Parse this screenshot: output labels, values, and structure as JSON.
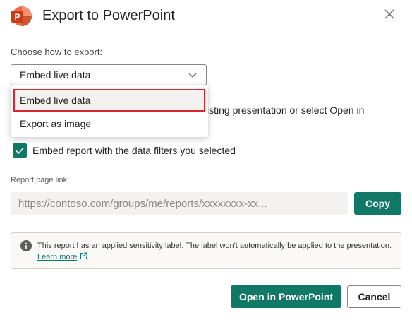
{
  "dialog": {
    "title": "Export to PowerPoint",
    "logo_letter": "P"
  },
  "export": {
    "choose_label": "Choose how to export:",
    "selected": "Embed live data",
    "options": [
      "Embed live data",
      "Export as image"
    ]
  },
  "hidden_description": {
    "line1_fragment": "isting presentation or select Open in"
  },
  "filters": {
    "checked": true,
    "label": "Embed report with the data filters you selected"
  },
  "link": {
    "label": "Report page link:",
    "value": "https://contoso.com/groups/me/reports/xxxxxxxx-xx...",
    "copy_label": "Copy"
  },
  "info": {
    "text": "This report has an applied sensitivity label. The label won't automatically be applied to the presentation.",
    "learn_more": "Learn more"
  },
  "footer": {
    "open_label": "Open in PowerPoint",
    "cancel_label": "Cancel"
  },
  "colors": {
    "accent": "#117865",
    "highlight_outline": "#d9262c",
    "powerpoint": "#c43e1c"
  }
}
